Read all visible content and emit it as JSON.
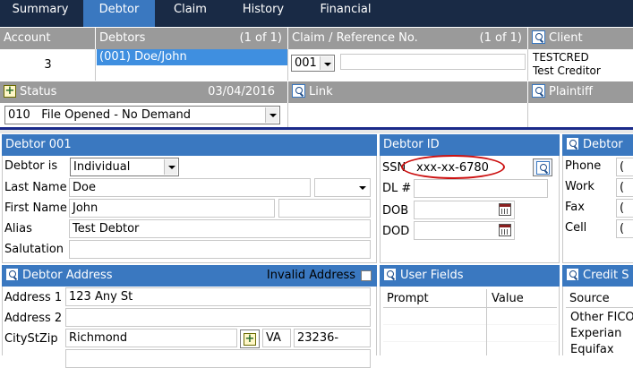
{
  "tabs": [
    {
      "label": "Summary",
      "active": false
    },
    {
      "label": "Debtor",
      "active": true
    },
    {
      "label": "Claim",
      "active": false
    },
    {
      "label": "History",
      "active": false
    },
    {
      "label": "Financial",
      "active": false
    }
  ],
  "top": {
    "account_header": "Account",
    "account_value": "3",
    "debtors_header": "Debtors",
    "debtors_count": "(1 of 1)",
    "debtor_selected": "(001) Doe/John",
    "claim_header": "Claim / Reference No.",
    "claim_count": "(1 of 1)",
    "claim_select": "001",
    "client_header": "Client",
    "client_code": "TESTCRED",
    "client_name": "Test Creditor",
    "status_header": "Status",
    "status_date": "03/04/2016",
    "status_value": "010   File Opened - No Demand",
    "link_header": "Link",
    "plaintiff_header": "Plaintiff"
  },
  "debtor": {
    "header": "Debtor 001",
    "debtor_is_label": "Debtor is",
    "debtor_is_value": "Individual",
    "last_name_label": "Last Name",
    "last_name": "Doe",
    "first_name_label": "First Name",
    "first_name": "John",
    "alias_label": "Alias",
    "alias": "Test Debtor",
    "salutation_label": "Salutation",
    "salutation": ""
  },
  "debtor_id": {
    "header": "Debtor ID",
    "ssn_label": "SSN",
    "ssn": "xxx-xx-6780",
    "dl_label": "DL #",
    "dob_label": "DOB",
    "dod_label": "DOD",
    "highlight_color": "#cc1111"
  },
  "contact": {
    "header": "Debtor P",
    "phone_label": "Phone",
    "work_label": "Work",
    "fax_label": "Fax",
    "cell_label": "Cell",
    "paren": "("
  },
  "address": {
    "header": "Debtor Address",
    "invalid_label": "Invalid Address",
    "address1_label": "Address 1",
    "address1": "123 Any St",
    "address2_label": "Address 2",
    "address2": "",
    "citystzip_label": "CityStZip",
    "city": "Richmond",
    "state": "VA",
    "zip": "23236-"
  },
  "user_fields": {
    "header": "User Fields",
    "col_prompt": "Prompt",
    "col_value": "Value"
  },
  "credit": {
    "header": "Credit S",
    "col_source": "Source",
    "rows": [
      "Other FICO",
      "Experian",
      "Equifax"
    ]
  },
  "colors": {
    "tab_bar": "#192a45",
    "tab_active": "#3a78c0",
    "gray_header": "#9a9a9a",
    "blue_header": "#3a78c0",
    "selected_row": "#3f8fe0",
    "divider": "#1a2a8a"
  }
}
